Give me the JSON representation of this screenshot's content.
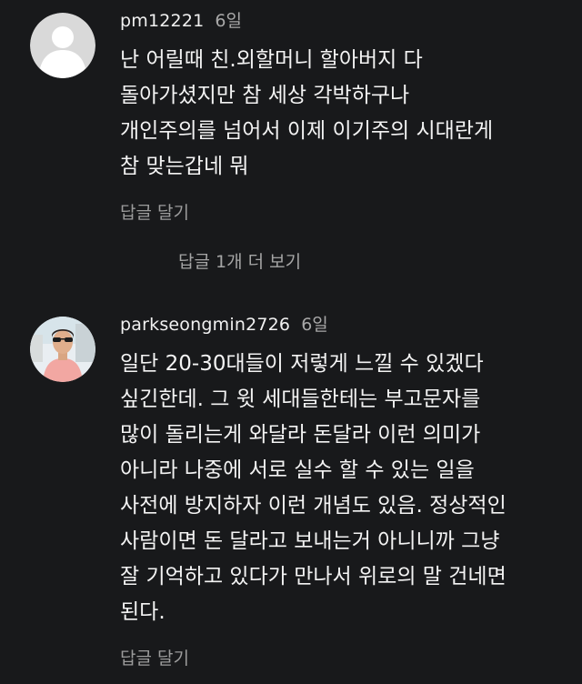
{
  "comments": [
    {
      "author": "pm12221",
      "time": "6일",
      "lines": [
        "난 어릴때 친.외할머니 할아버지 다",
        "돌아가셨지만 참 세상 각박하구나",
        "개인주의를 넘어서 이제 이기주의 시대란게",
        "참 맞는갑네 뭐"
      ],
      "reply_label": "답글 달기"
    },
    {
      "author": "parkseongmin2726",
      "time": "6일",
      "lines": [
        "일단 20-30대들이 저렇게 느낄 수 있겠다",
        "싶긴한데. 그 윗 세대들한테는 부고문자를",
        "많이 돌리는게 와달라 돈달라 이런 의미가",
        "아니라 나중에 서로 실수 할 수 있는 일을",
        "사전에 방지하자 이런 개념도 있음. 정상적인",
        "사람이면 돈 달라고 보내는거 아니니까 그냥",
        "잘 기억하고 있다가 만나서 위로의 말 건네면",
        "된다."
      ],
      "reply_label": "답글 달기"
    }
  ],
  "view_replies_label": "답글 1개 더 보기"
}
